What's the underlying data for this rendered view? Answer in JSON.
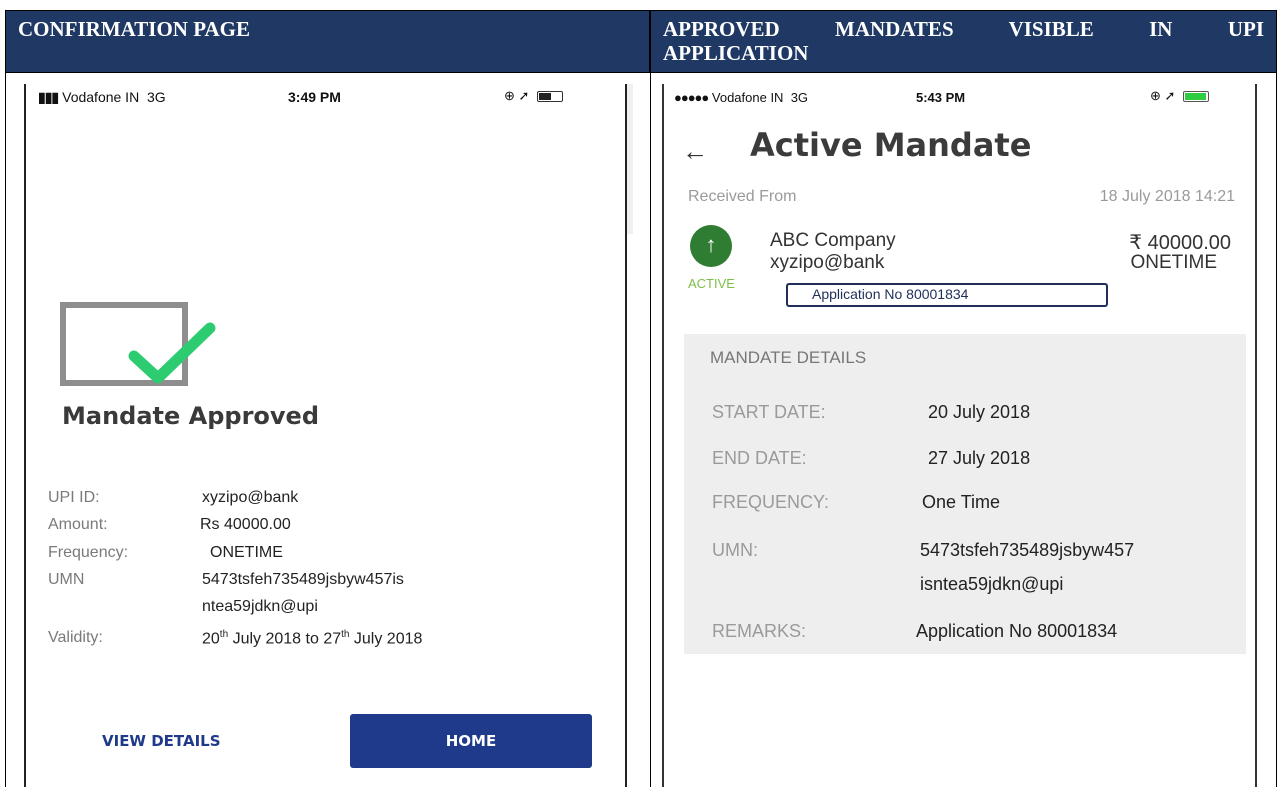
{
  "headers": {
    "left": "CONFIRMATION PAGE",
    "right_line1": "APPROVED MANDATES VISIBLE IN UPI",
    "right_line2": "APPLICATION"
  },
  "left_screen": {
    "status": {
      "carrier": "Vodafone IN",
      "network": "3G",
      "time": "3:49 PM"
    },
    "title": "Mandate Approved",
    "fields": [
      {
        "label": "UPI ID:",
        "value": "xyzipo@bank"
      },
      {
        "label": "Amount:",
        "value": "Rs 40000.00"
      },
      {
        "label": "Frequency:",
        "value": "ONETIME"
      },
      {
        "label": "UMN",
        "value": "5473tsfeh735489jsbyw457is",
        "value2": "ntea59jdkn@upi"
      },
      {
        "label": "Validity:",
        "value_parts": [
          "20",
          "th",
          " July 2018 to 27",
          "th",
          " July 2018"
        ]
      }
    ],
    "buttons": {
      "view_details": "VIEW DETAILS",
      "home": "HOME"
    }
  },
  "right_screen": {
    "status": {
      "carrier": "Vodafone IN",
      "network": "3G",
      "time": "5:43 PM"
    },
    "title": "Active Mandate",
    "received_from_label": "Received From",
    "received_date": "18 July 2018 14:21",
    "payee_name": "ABC Company",
    "payee_upi": "xyzipo@bank",
    "amount": "₹ 40000.00",
    "frequency": "ONETIME",
    "status_label": "ACTIVE",
    "application_no": "Application No 80001834",
    "details": {
      "heading": "MANDATE DETAILS",
      "rows": [
        {
          "label": "START DATE:",
          "value": "20 July 2018"
        },
        {
          "label": "END DATE:",
          "value": "27 July 2018"
        },
        {
          "label": "FREQUENCY:",
          "value": "One Time"
        },
        {
          "label": "UMN:",
          "value": "5473tsfeh735489jsbyw457",
          "value2": "isntea59jdkn@upi"
        },
        {
          "label": "REMARKS:",
          "value": "Application No 80001834"
        }
      ]
    }
  },
  "colors": {
    "header_bg": "#1f3864",
    "button_blue": "#1f3a8a",
    "check_green": "#2ecc71",
    "active_green": "#2e7d32"
  }
}
